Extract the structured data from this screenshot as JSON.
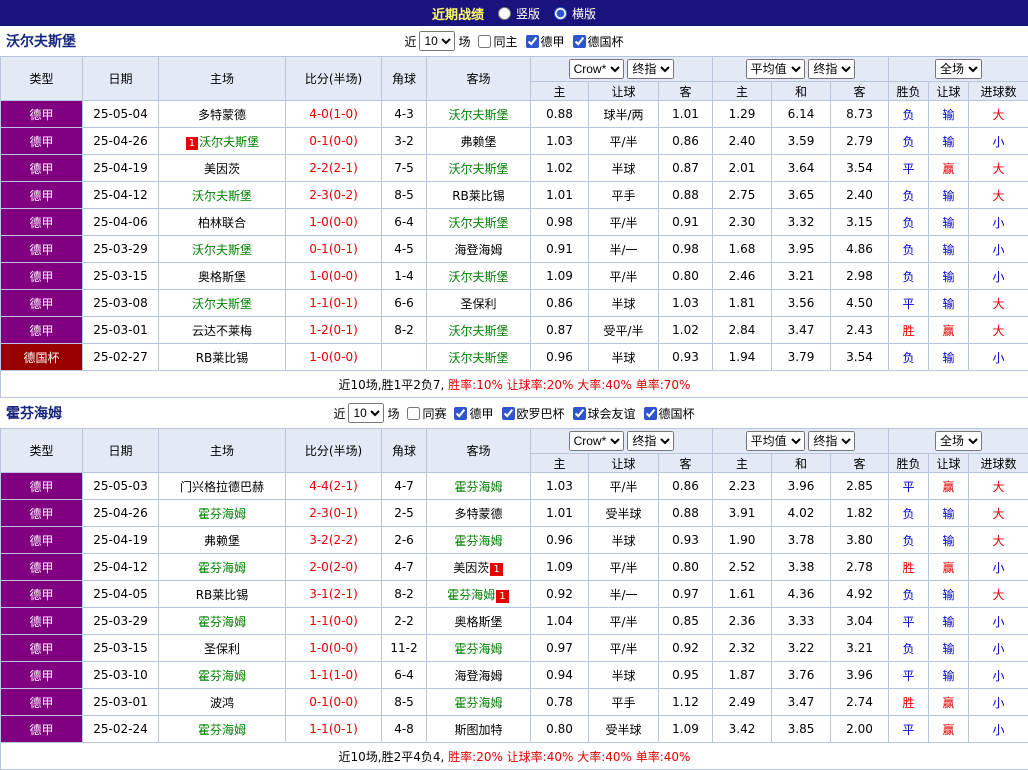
{
  "header": {
    "title": "近期战绩",
    "vertical_label": "竖版",
    "horizontal_label": "横版"
  },
  "filter_labels": {
    "recent": "近",
    "matches": "场"
  },
  "selects": {
    "count": "10",
    "provider": "Crow*",
    "stage": "终指",
    "average": "平均值",
    "scope": "全场"
  },
  "table_labels": {
    "type": "类型",
    "date": "日期",
    "home": "主场",
    "score": "比分(半场)",
    "corner": "角球",
    "away": "客场",
    "h_home": "主",
    "h_handicap": "让球",
    "h_away": "客",
    "a_home": "主",
    "a_draw": "和",
    "a_away": "客",
    "r_result": "胜负",
    "r_handicap": "让球",
    "r_goals": "进球数"
  },
  "colors": {
    "topbar": "#1a127d",
    "league_purple": "#800080",
    "cup_red": "#990000",
    "focus_green": "#008000",
    "result_red": "#e60000",
    "result_blue": "#0000cc"
  },
  "sections": [
    {
      "team": "沃尔夫斯堡",
      "filters": [
        {
          "label": "同主",
          "checked": false
        },
        {
          "label": "德甲",
          "checked": true
        },
        {
          "label": "德国杯",
          "checked": true
        }
      ],
      "rows": [
        {
          "league": "德甲",
          "style": "league",
          "date": "25-05-04",
          "home": {
            "name": "多特蒙德",
            "focus": false
          },
          "score": "4-0(1-0)",
          "corner": "4-3",
          "away": {
            "name": "沃尔夫斯堡",
            "focus": true
          },
          "odds": [
            "0.88",
            "球半/两",
            "1.01"
          ],
          "avg": [
            "1.29",
            "6.14",
            "8.73"
          ],
          "res": [
            [
              "负",
              "blue"
            ],
            [
              "输",
              "blue"
            ],
            [
              "大",
              "red"
            ]
          ]
        },
        {
          "league": "德甲",
          "style": "league",
          "date": "25-04-26",
          "home": {
            "name": "沃尔夫斯堡",
            "focus": true,
            "badge": "1",
            "badge_pos": "left"
          },
          "score": "0-1(0-0)",
          "corner": "3-2",
          "away": {
            "name": "弗赖堡",
            "focus": false
          },
          "odds": [
            "1.03",
            "平/半",
            "0.86"
          ],
          "avg": [
            "2.40",
            "3.59",
            "2.79"
          ],
          "res": [
            [
              "负",
              "blue"
            ],
            [
              "输",
              "blue"
            ],
            [
              "小",
              "blue"
            ]
          ]
        },
        {
          "league": "德甲",
          "style": "league",
          "date": "25-04-19",
          "home": {
            "name": "美因茨",
            "focus": false
          },
          "score": "2-2(2-1)",
          "corner": "7-5",
          "away": {
            "name": "沃尔夫斯堡",
            "focus": true
          },
          "odds": [
            "1.02",
            "半球",
            "0.87"
          ],
          "avg": [
            "2.01",
            "3.64",
            "3.54"
          ],
          "res": [
            [
              "平",
              "blue"
            ],
            [
              "赢",
              "red"
            ],
            [
              "大",
              "red"
            ]
          ]
        },
        {
          "league": "德甲",
          "style": "league",
          "date": "25-04-12",
          "home": {
            "name": "沃尔夫斯堡",
            "focus": true
          },
          "score": "2-3(0-2)",
          "corner": "8-5",
          "away": {
            "name": "RB莱比锡",
            "focus": false
          },
          "odds": [
            "1.01",
            "平手",
            "0.88"
          ],
          "avg": [
            "2.75",
            "3.65",
            "2.40"
          ],
          "res": [
            [
              "负",
              "blue"
            ],
            [
              "输",
              "blue"
            ],
            [
              "大",
              "red"
            ]
          ]
        },
        {
          "league": "德甲",
          "style": "league",
          "date": "25-04-06",
          "home": {
            "name": "柏林联合",
            "focus": false
          },
          "score": "1-0(0-0)",
          "corner": "6-4",
          "away": {
            "name": "沃尔夫斯堡",
            "focus": true
          },
          "odds": [
            "0.98",
            "平/半",
            "0.91"
          ],
          "avg": [
            "2.30",
            "3.32",
            "3.15"
          ],
          "res": [
            [
              "负",
              "blue"
            ],
            [
              "输",
              "blue"
            ],
            [
              "小",
              "blue"
            ]
          ]
        },
        {
          "league": "德甲",
          "style": "league",
          "date": "25-03-29",
          "home": {
            "name": "沃尔夫斯堡",
            "focus": true
          },
          "score": "0-1(0-1)",
          "corner": "4-5",
          "away": {
            "name": "海登海姆",
            "focus": false
          },
          "odds": [
            "0.91",
            "半/一",
            "0.98"
          ],
          "avg": [
            "1.68",
            "3.95",
            "4.86"
          ],
          "res": [
            [
              "负",
              "blue"
            ],
            [
              "输",
              "blue"
            ],
            [
              "小",
              "blue"
            ]
          ]
        },
        {
          "league": "德甲",
          "style": "league",
          "date": "25-03-15",
          "home": {
            "name": "奥格斯堡",
            "focus": false
          },
          "score": "1-0(0-0)",
          "corner": "1-4",
          "away": {
            "name": "沃尔夫斯堡",
            "focus": true
          },
          "odds": [
            "1.09",
            "平/半",
            "0.80"
          ],
          "avg": [
            "2.46",
            "3.21",
            "2.98"
          ],
          "res": [
            [
              "负",
              "blue"
            ],
            [
              "输",
              "blue"
            ],
            [
              "小",
              "blue"
            ]
          ]
        },
        {
          "league": "德甲",
          "style": "league",
          "date": "25-03-08",
          "home": {
            "name": "沃尔夫斯堡",
            "focus": true
          },
          "score": "1-1(0-1)",
          "corner": "6-6",
          "away": {
            "name": "圣保利",
            "focus": false
          },
          "odds": [
            "0.86",
            "半球",
            "1.03"
          ],
          "avg": [
            "1.81",
            "3.56",
            "4.50"
          ],
          "res": [
            [
              "平",
              "blue"
            ],
            [
              "输",
              "blue"
            ],
            [
              "大",
              "red"
            ]
          ]
        },
        {
          "league": "德甲",
          "style": "league",
          "date": "25-03-01",
          "home": {
            "name": "云达不莱梅",
            "focus": false
          },
          "score": "1-2(0-1)",
          "corner": "8-2",
          "away": {
            "name": "沃尔夫斯堡",
            "focus": true
          },
          "odds": [
            "0.87",
            "受平/半",
            "1.02"
          ],
          "avg": [
            "2.84",
            "3.47",
            "2.43"
          ],
          "res": [
            [
              "胜",
              "red"
            ],
            [
              "赢",
              "red"
            ],
            [
              "大",
              "red"
            ]
          ]
        },
        {
          "league": "德国杯",
          "style": "cup",
          "date": "25-02-27",
          "home": {
            "name": "RB莱比锡",
            "focus": false
          },
          "score": "1-0(0-0)",
          "corner": "",
          "away": {
            "name": "沃尔夫斯堡",
            "focus": true
          },
          "odds": [
            "0.96",
            "半球",
            "0.93"
          ],
          "avg": [
            "1.94",
            "3.79",
            "3.54"
          ],
          "res": [
            [
              "负",
              "blue"
            ],
            [
              "输",
              "blue"
            ],
            [
              "小",
              "blue"
            ]
          ]
        }
      ],
      "summary": {
        "lead": "近10场,胜1平2负7, ",
        "rates": "胜率:10% 让球率:20% 大率:40% 单率:70%"
      }
    },
    {
      "team": "霍芬海姆",
      "filters": [
        {
          "label": "同赛",
          "checked": false
        },
        {
          "label": "德甲",
          "checked": true
        },
        {
          "label": "欧罗巴杯",
          "checked": true
        },
        {
          "label": "球会友谊",
          "checked": true
        },
        {
          "label": "德国杯",
          "checked": true
        }
      ],
      "rows": [
        {
          "league": "德甲",
          "style": "league",
          "date": "25-05-03",
          "home": {
            "name": "门兴格拉德巴赫",
            "focus": false
          },
          "score": "4-4(2-1)",
          "corner": "4-7",
          "away": {
            "name": "霍芬海姆",
            "focus": true
          },
          "odds": [
            "1.03",
            "平/半",
            "0.86"
          ],
          "avg": [
            "2.23",
            "3.96",
            "2.85"
          ],
          "res": [
            [
              "平",
              "blue"
            ],
            [
              "赢",
              "red"
            ],
            [
              "大",
              "red"
            ]
          ]
        },
        {
          "league": "德甲",
          "style": "league",
          "date": "25-04-26",
          "home": {
            "name": "霍芬海姆",
            "focus": true
          },
          "score": "2-3(0-1)",
          "corner": "2-5",
          "away": {
            "name": "多特蒙德",
            "focus": false
          },
          "odds": [
            "1.01",
            "受半球",
            "0.88"
          ],
          "avg": [
            "3.91",
            "4.02",
            "1.82"
          ],
          "res": [
            [
              "负",
              "blue"
            ],
            [
              "输",
              "blue"
            ],
            [
              "大",
              "red"
            ]
          ]
        },
        {
          "league": "德甲",
          "style": "league",
          "date": "25-04-19",
          "home": {
            "name": "弗赖堡",
            "focus": false
          },
          "score": "3-2(2-2)",
          "corner": "2-6",
          "away": {
            "name": "霍芬海姆",
            "focus": true
          },
          "odds": [
            "0.96",
            "半球",
            "0.93"
          ],
          "avg": [
            "1.90",
            "3.78",
            "3.80"
          ],
          "res": [
            [
              "负",
              "blue"
            ],
            [
              "输",
              "blue"
            ],
            [
              "大",
              "red"
            ]
          ]
        },
        {
          "league": "德甲",
          "style": "league",
          "date": "25-04-12",
          "home": {
            "name": "霍芬海姆",
            "focus": true
          },
          "score": "2-0(2-0)",
          "corner": "4-7",
          "away": {
            "name": "美因茨",
            "focus": false,
            "badge": "1",
            "badge_pos": "right"
          },
          "odds": [
            "1.09",
            "平/半",
            "0.80"
          ],
          "avg": [
            "2.52",
            "3.38",
            "2.78"
          ],
          "res": [
            [
              "胜",
              "red"
            ],
            [
              "赢",
              "red"
            ],
            [
              "小",
              "blue"
            ]
          ]
        },
        {
          "league": "德甲",
          "style": "league",
          "date": "25-04-05",
          "home": {
            "name": "RB莱比锡",
            "focus": false
          },
          "score": "3-1(2-1)",
          "corner": "8-2",
          "away": {
            "name": "霍芬海姆",
            "focus": true,
            "badge": "1",
            "badge_pos": "right"
          },
          "odds": [
            "0.92",
            "半/一",
            "0.97"
          ],
          "avg": [
            "1.61",
            "4.36",
            "4.92"
          ],
          "res": [
            [
              "负",
              "blue"
            ],
            [
              "输",
              "blue"
            ],
            [
              "大",
              "red"
            ]
          ]
        },
        {
          "league": "德甲",
          "style": "league",
          "date": "25-03-29",
          "home": {
            "name": "霍芬海姆",
            "focus": true
          },
          "score": "1-1(0-0)",
          "corner": "2-2",
          "away": {
            "name": "奥格斯堡",
            "focus": false
          },
          "odds": [
            "1.04",
            "平/半",
            "0.85"
          ],
          "avg": [
            "2.36",
            "3.33",
            "3.04"
          ],
          "res": [
            [
              "平",
              "blue"
            ],
            [
              "输",
              "blue"
            ],
            [
              "小",
              "blue"
            ]
          ]
        },
        {
          "league": "德甲",
          "style": "league",
          "date": "25-03-15",
          "home": {
            "name": "圣保利",
            "focus": false
          },
          "score": "1-0(0-0)",
          "corner": "11-2",
          "away": {
            "name": "霍芬海姆",
            "focus": true
          },
          "odds": [
            "0.97",
            "平/半",
            "0.92"
          ],
          "avg": [
            "2.32",
            "3.22",
            "3.21"
          ],
          "res": [
            [
              "负",
              "blue"
            ],
            [
              "输",
              "blue"
            ],
            [
              "小",
              "blue"
            ]
          ]
        },
        {
          "league": "德甲",
          "style": "league",
          "date": "25-03-10",
          "home": {
            "name": "霍芬海姆",
            "focus": true
          },
          "score": "1-1(1-0)",
          "corner": "6-4",
          "away": {
            "name": "海登海姆",
            "focus": false
          },
          "odds": [
            "0.94",
            "半球",
            "0.95"
          ],
          "avg": [
            "1.87",
            "3.76",
            "3.96"
          ],
          "res": [
            [
              "平",
              "blue"
            ],
            [
              "输",
              "blue"
            ],
            [
              "小",
              "blue"
            ]
          ]
        },
        {
          "league": "德甲",
          "style": "league",
          "date": "25-03-01",
          "home": {
            "name": "波鸿",
            "focus": false
          },
          "score": "0-1(0-0)",
          "corner": "8-5",
          "away": {
            "name": "霍芬海姆",
            "focus": true
          },
          "odds": [
            "0.78",
            "平手",
            "1.12"
          ],
          "avg": [
            "2.49",
            "3.47",
            "2.74"
          ],
          "res": [
            [
              "胜",
              "red"
            ],
            [
              "赢",
              "red"
            ],
            [
              "小",
              "blue"
            ]
          ]
        },
        {
          "league": "德甲",
          "style": "league",
          "date": "25-02-24",
          "home": {
            "name": "霍芬海姆",
            "focus": true
          },
          "score": "1-1(0-1)",
          "corner": "4-8",
          "away": {
            "name": "斯图加特",
            "focus": false
          },
          "odds": [
            "0.80",
            "受半球",
            "1.09"
          ],
          "avg": [
            "3.42",
            "3.85",
            "2.00"
          ],
          "res": [
            [
              "平",
              "blue"
            ],
            [
              "赢",
              "red"
            ],
            [
              "小",
              "blue"
            ]
          ]
        }
      ],
      "summary": {
        "lead": "近10场,胜2平4负4, ",
        "rates": "胜率:20% 让球率:40% 大率:40% 单率:40%"
      }
    }
  ]
}
